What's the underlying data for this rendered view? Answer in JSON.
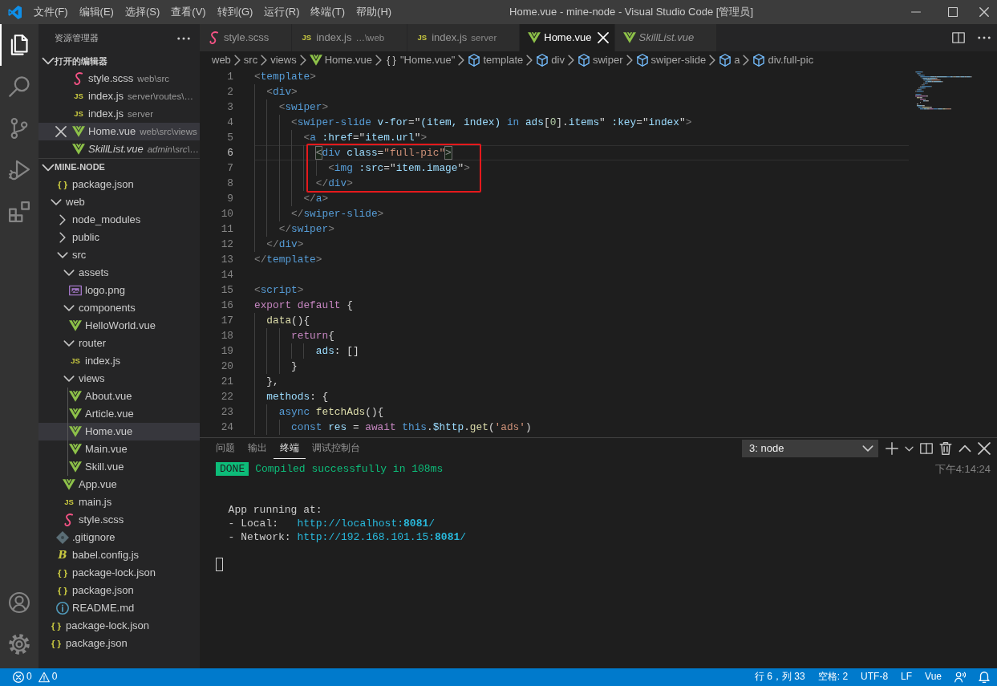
{
  "title_bar": {
    "menu": [
      "文件(F)",
      "编辑(E)",
      "选择(S)",
      "查看(V)",
      "转到(G)",
      "运行(R)",
      "终端(T)",
      "帮助(H)"
    ],
    "title": "Home.vue - mine-node - Visual Studio Code [管理员]"
  },
  "activity_bar": {
    "items": [
      {
        "kind": "explorer",
        "selected": true
      },
      {
        "kind": "search",
        "selected": false
      },
      {
        "kind": "source-control",
        "selected": false
      },
      {
        "kind": "debug",
        "selected": false
      },
      {
        "kind": "extensions",
        "selected": false
      }
    ],
    "bottom": [
      {
        "kind": "account"
      },
      {
        "kind": "settings"
      }
    ]
  },
  "sidebar": {
    "title": "资源管理器",
    "open_editors": {
      "title": "打开的编辑器",
      "expanded": true,
      "items": [
        {
          "kind": "scss",
          "label": "style.scss",
          "description": "web\\src",
          "selected": false,
          "preview": false
        },
        {
          "kind": "js",
          "icon_text": "JS",
          "label": "index.js",
          "description": "server\\routes\\…",
          "selected": false,
          "preview": false
        },
        {
          "kind": "js",
          "icon_text": "JS",
          "label": "index.js",
          "description": "server",
          "selected": false,
          "preview": false
        },
        {
          "kind": "vue",
          "label": "Home.vue",
          "description": "web\\src\\views",
          "selected": true,
          "preview": false
        },
        {
          "kind": "vue",
          "label": "SkillList.vue",
          "description": "admin\\src\\…",
          "selected": false,
          "preview": true
        }
      ]
    },
    "explorer": {
      "title": "MINE-NODE",
      "expanded": true,
      "items": [
        {
          "kind": "partial-folder",
          "children": [
            {
              "kind": "json",
              "icon_text": "{ }",
              "label": "package.json",
              "selected": false
            }
          ]
        },
        {
          "kind": "folder",
          "label": "web",
          "expanded": true,
          "selected": false,
          "children": [
            {
              "kind": "folder",
              "label": "node_modules",
              "expanded": false,
              "selected": false
            },
            {
              "kind": "folder",
              "label": "public",
              "expanded": false,
              "selected": false
            },
            {
              "kind": "folder",
              "label": "src",
              "expanded": true,
              "selected": false,
              "children": [
                {
                  "kind": "folder",
                  "label": "assets",
                  "expanded": true,
                  "selected": false,
                  "children": [
                    {
                      "kind": "image",
                      "label": "logo.png",
                      "selected": false
                    }
                  ]
                },
                {
                  "kind": "folder",
                  "label": "components",
                  "expanded": true,
                  "selected": false,
                  "children": [
                    {
                      "kind": "vue",
                      "label": "HelloWorld.vue",
                      "selected": false
                    }
                  ]
                },
                {
                  "kind": "folder",
                  "label": "router",
                  "expanded": true,
                  "selected": false,
                  "children": [
                    {
                      "kind": "js",
                      "icon_text": "JS",
                      "label": "index.js",
                      "selected": false
                    }
                  ]
                },
                {
                  "kind": "folder",
                  "label": "views",
                  "expanded": true,
                  "selected": false,
                  "children": [
                    {
                      "kind": "vue",
                      "label": "About.vue",
                      "selected": false
                    },
                    {
                      "kind": "vue",
                      "label": "Article.vue",
                      "selected": false
                    },
                    {
                      "kind": "vue",
                      "label": "Home.vue",
                      "selected": true
                    },
                    {
                      "kind": "vue",
                      "label": "Main.vue",
                      "selected": false
                    },
                    {
                      "kind": "vue",
                      "label": "Skill.vue",
                      "selected": false
                    }
                  ]
                },
                {
                  "kind": "vue",
                  "label": "App.vue",
                  "selected": false
                },
                {
                  "kind": "js",
                  "icon_text": "JS",
                  "label": "main.js",
                  "selected": false
                },
                {
                  "kind": "scss",
                  "label": "style.scss",
                  "selected": false
                }
              ]
            },
            {
              "kind": "git",
              "label": ".gitignore",
              "selected": false
            },
            {
              "kind": "babel",
              "icon_text": "B",
              "label": "babel.config.js",
              "selected": false
            },
            {
              "kind": "json",
              "icon_text": "{ }",
              "label": "package-lock.json",
              "selected": false
            },
            {
              "kind": "json",
              "icon_text": "{ }",
              "label": "package.json",
              "selected": false
            },
            {
              "kind": "info",
              "label": "README.md",
              "selected": false
            }
          ]
        },
        {
          "kind": "json",
          "icon_text": "{ }",
          "label": "package-lock.json",
          "selected": false
        },
        {
          "kind": "json",
          "icon_text": "{ }",
          "label": "package.json",
          "selected": false
        }
      ]
    }
  },
  "editor": {
    "tabs": [
      {
        "kind": "scss",
        "label": "style.scss",
        "selected": false,
        "preview": false
      },
      {
        "kind": "js",
        "icon_text": "JS",
        "label": "index.js",
        "description": "…\\web",
        "selected": false,
        "preview": false
      },
      {
        "kind": "js",
        "icon_text": "JS",
        "label": "index.js",
        "description": "server",
        "selected": false,
        "preview": false
      },
      {
        "kind": "vue",
        "label": "Home.vue",
        "selected": true,
        "preview": false
      },
      {
        "kind": "vue",
        "label": "SkillList.vue",
        "selected": false,
        "preview": true
      }
    ],
    "breadcrumbs": [
      {
        "kind": "folder",
        "label": "web"
      },
      {
        "kind": "folder",
        "label": "src"
      },
      {
        "kind": "folder",
        "label": "views"
      },
      {
        "kind": "vue",
        "label": "Home.vue"
      },
      {
        "kind": "module",
        "icon_text": "{ }",
        "label": "\"Home.vue\""
      },
      {
        "kind": "element",
        "label": "template"
      },
      {
        "kind": "element",
        "label": "div"
      },
      {
        "kind": "element",
        "label": "swiper"
      },
      {
        "kind": "element",
        "label": "swiper-slide"
      },
      {
        "kind": "element",
        "label": "a"
      },
      {
        "kind": "element",
        "label": "div.full-pic"
      }
    ],
    "lines": [
      {
        "number": "1",
        "current": false,
        "annotated": false,
        "tokens": [
          {
            "kind": "punct",
            "text": "<"
          },
          {
            "kind": "tag",
            "text": "template"
          },
          {
            "kind": "punct",
            "text": ">"
          }
        ]
      },
      {
        "number": "2",
        "current": false,
        "annotated": false,
        "tokens": [
          {
            "kind": "punct",
            "text": "  <"
          },
          {
            "kind": "tag",
            "text": "div"
          },
          {
            "kind": "punct",
            "text": ">"
          }
        ]
      },
      {
        "number": "3",
        "current": false,
        "annotated": false,
        "tokens": [
          {
            "kind": "punct",
            "text": "    <"
          },
          {
            "kind": "tag",
            "text": "swiper"
          },
          {
            "kind": "punct",
            "text": ">"
          }
        ]
      },
      {
        "number": "4",
        "current": false,
        "annotated": false,
        "tokens": [
          {
            "kind": "punct",
            "text": "      <"
          },
          {
            "kind": "tag",
            "text": "swiper-slide"
          },
          {
            "kind": "attr",
            "text": " v-for"
          },
          {
            "kind": "plain",
            "text": "=\""
          },
          {
            "kind": "var",
            "text": "(item, index)"
          },
          {
            "kind": "keyword",
            "text": " in "
          },
          {
            "kind": "var",
            "text": "ads"
          },
          {
            "kind": "plain",
            "text": "["
          },
          {
            "kind": "number",
            "text": "0"
          },
          {
            "kind": "plain",
            "text": "]."
          },
          {
            "kind": "var",
            "text": "items"
          },
          {
            "kind": "plain",
            "text": "\""
          },
          {
            "kind": "attr",
            "text": " :key"
          },
          {
            "kind": "plain",
            "text": "=\""
          },
          {
            "kind": "var",
            "text": "index"
          },
          {
            "kind": "plain",
            "text": "\""
          },
          {
            "kind": "punct",
            "text": ">"
          }
        ]
      },
      {
        "number": "5",
        "current": false,
        "annotated": false,
        "tokens": [
          {
            "kind": "punct",
            "text": "        <"
          },
          {
            "kind": "tag",
            "text": "a"
          },
          {
            "kind": "attr",
            "text": " :href"
          },
          {
            "kind": "plain",
            "text": "=\""
          },
          {
            "kind": "var",
            "text": "item.url"
          },
          {
            "kind": "plain",
            "text": "\""
          },
          {
            "kind": "punct",
            "text": ">"
          }
        ]
      },
      {
        "number": "6",
        "current": true,
        "annotated": true,
        "tokens": [
          {
            "kind": "bracket-match",
            "text": "          <"
          },
          {
            "kind": "tag",
            "text": "div"
          },
          {
            "kind": "attr",
            "text": " class"
          },
          {
            "kind": "plain",
            "text": "="
          },
          {
            "kind": "string",
            "text": "\"full-pic\""
          },
          {
            "kind": "bracket-match",
            "text": ">"
          }
        ]
      },
      {
        "number": "7",
        "current": false,
        "annotated": true,
        "tokens": [
          {
            "kind": "punct",
            "text": "            <"
          },
          {
            "kind": "tag",
            "text": "img"
          },
          {
            "kind": "attr",
            "text": " :src"
          },
          {
            "kind": "plain",
            "text": "=\""
          },
          {
            "kind": "var",
            "text": "item.image"
          },
          {
            "kind": "plain",
            "text": "\""
          },
          {
            "kind": "punct",
            "text": ">"
          }
        ]
      },
      {
        "number": "8",
        "current": false,
        "annotated": true,
        "tokens": [
          {
            "kind": "punct",
            "text": "          </"
          },
          {
            "kind": "tag",
            "text": "div"
          },
          {
            "kind": "punct",
            "text": ">"
          }
        ]
      },
      {
        "number": "9",
        "current": false,
        "annotated": false,
        "tokens": [
          {
            "kind": "punct",
            "text": "        </"
          },
          {
            "kind": "tag",
            "text": "a"
          },
          {
            "kind": "punct",
            "text": ">"
          }
        ]
      },
      {
        "number": "10",
        "current": false,
        "annotated": false,
        "tokens": [
          {
            "kind": "punct",
            "text": "      </"
          },
          {
            "kind": "tag",
            "text": "swiper-slide"
          },
          {
            "kind": "punct",
            "text": ">"
          }
        ]
      },
      {
        "number": "11",
        "current": false,
        "annotated": false,
        "tokens": [
          {
            "kind": "punct",
            "text": "    </"
          },
          {
            "kind": "tag",
            "text": "swiper"
          },
          {
            "kind": "punct",
            "text": ">"
          }
        ]
      },
      {
        "number": "12",
        "current": false,
        "annotated": false,
        "tokens": [
          {
            "kind": "punct",
            "text": "  </"
          },
          {
            "kind": "tag",
            "text": "div"
          },
          {
            "kind": "punct",
            "text": ">"
          }
        ]
      },
      {
        "number": "13",
        "current": false,
        "annotated": false,
        "tokens": [
          {
            "kind": "punct",
            "text": "</"
          },
          {
            "kind": "tag",
            "text": "template"
          },
          {
            "kind": "punct",
            "text": ">"
          }
        ]
      },
      {
        "number": "14",
        "current": false,
        "annotated": false
      },
      {
        "number": "15",
        "current": false,
        "annotated": false,
        "tokens": [
          {
            "kind": "punct",
            "text": "<"
          },
          {
            "kind": "tag",
            "text": "script"
          },
          {
            "kind": "punct",
            "text": ">"
          }
        ]
      },
      {
        "number": "16",
        "current": false,
        "annotated": false,
        "tokens": [
          {
            "kind": "control",
            "text": "export"
          },
          {
            "kind": "control",
            "text": " default"
          },
          {
            "kind": "plain",
            "text": " {"
          }
        ]
      },
      {
        "number": "17",
        "current": false,
        "annotated": false,
        "tokens": [
          {
            "kind": "func",
            "text": "  data"
          },
          {
            "kind": "plain",
            "text": "(){"
          }
        ]
      },
      {
        "number": "18",
        "current": false,
        "annotated": false,
        "tokens": [
          {
            "kind": "control",
            "text": "      return"
          },
          {
            "kind": "plain",
            "text": "{"
          }
        ]
      },
      {
        "number": "19",
        "current": false,
        "annotated": false,
        "tokens": [
          {
            "kind": "var",
            "text": "          ads"
          },
          {
            "kind": "plain",
            "text": ": []"
          }
        ]
      },
      {
        "number": "20",
        "current": false,
        "annotated": false,
        "tokens": [
          {
            "kind": "plain",
            "text": "      }"
          }
        ]
      },
      {
        "number": "21",
        "current": false,
        "annotated": false,
        "tokens": [
          {
            "kind": "plain",
            "text": "  },"
          }
        ]
      },
      {
        "number": "22",
        "current": false,
        "annotated": false,
        "tokens": [
          {
            "kind": "var",
            "text": "  methods"
          },
          {
            "kind": "plain",
            "text": ": {"
          }
        ]
      },
      {
        "number": "23",
        "current": false,
        "annotated": false,
        "tokens": [
          {
            "kind": "keyword",
            "text": "    async"
          },
          {
            "kind": "func",
            "text": " fetchAds"
          },
          {
            "kind": "plain",
            "text": "(){"
          }
        ]
      },
      {
        "number": "24",
        "current": false,
        "annotated": false,
        "tokens": [
          {
            "kind": "keyword",
            "text": "      const"
          },
          {
            "kind": "var",
            "text": " res"
          },
          {
            "kind": "plain",
            "text": " = "
          },
          {
            "kind": "control",
            "text": "await"
          },
          {
            "kind": "keyword",
            "text": " this"
          },
          {
            "kind": "plain",
            "text": "."
          },
          {
            "kind": "var",
            "text": "$http"
          },
          {
            "kind": "plain",
            "text": "."
          },
          {
            "kind": "func",
            "text": "get"
          },
          {
            "kind": "plain",
            "text": "("
          },
          {
            "kind": "string",
            "text": "'ads'"
          },
          {
            "kind": "plain",
            "text": ")"
          }
        ]
      }
    ]
  },
  "panel": {
    "tabs": [
      {
        "label": "问题",
        "selected": false
      },
      {
        "label": "输出",
        "selected": false
      },
      {
        "label": "终端",
        "selected": true
      },
      {
        "label": "调试控制台",
        "selected": false
      }
    ],
    "terminal_select": "3: node",
    "terminal": {
      "badge": "DONE",
      "message": "Compiled successfully in 108ms",
      "time": "下午4:14:24",
      "lines": [
        {
          "text": "App running at:"
        },
        {
          "text": "- Local:",
          "url": "http://localhost:**8081**/"
        },
        {
          "text": "- Network:",
          "url": "http://192.168.101.15:**8081**/"
        }
      ],
      "cursor": true
    }
  },
  "status_bar": {
    "errors": "0",
    "warnings": "0",
    "items": [
      "行 6，列 33",
      "空格: 2",
      "UTF-8",
      "LF",
      "Vue"
    ]
  }
}
